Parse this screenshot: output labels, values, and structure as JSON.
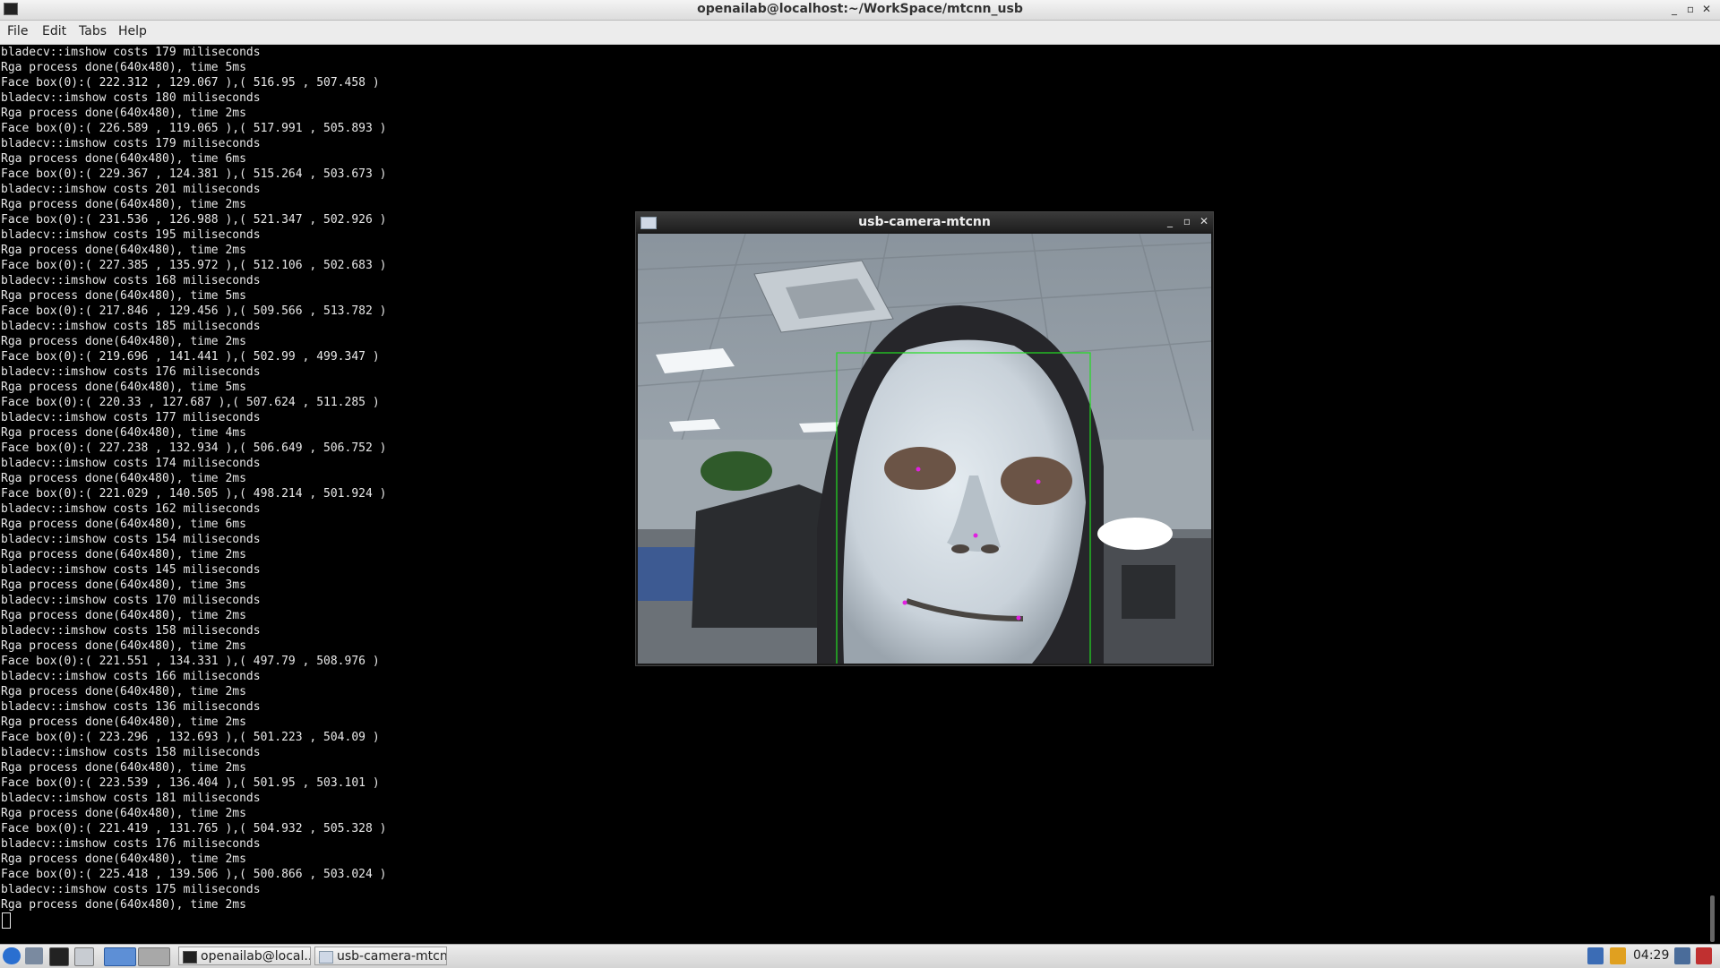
{
  "window": {
    "title": "openailab@localhost:~/WorkSpace/mtcnn_usb",
    "controls": [
      "_",
      "▫",
      "✕"
    ]
  },
  "menu": [
    "File",
    "Edit",
    "Tabs",
    "Help"
  ],
  "terminal_lines": [
    "bladecv::imshow costs 179 miliseconds",
    "Rga process done(640x480), time 5ms",
    "Face box(0):( 222.312 , 129.067 ),( 516.95 , 507.458 )",
    "bladecv::imshow costs 180 miliseconds",
    "Rga process done(640x480), time 2ms",
    "Face box(0):( 226.589 , 119.065 ),( 517.991 , 505.893 )",
    "bladecv::imshow costs 179 miliseconds",
    "Rga process done(640x480), time 6ms",
    "Face box(0):( 229.367 , 124.381 ),( 515.264 , 503.673 )",
    "bladecv::imshow costs 201 miliseconds",
    "Rga process done(640x480), time 2ms",
    "Face box(0):( 231.536 , 126.988 ),( 521.347 , 502.926 )",
    "bladecv::imshow costs 195 miliseconds",
    "Rga process done(640x480), time 2ms",
    "Face box(0):( 227.385 , 135.972 ),( 512.106 , 502.683 )",
    "bladecv::imshow costs 168 miliseconds",
    "Rga process done(640x480), time 5ms",
    "Face box(0):( 217.846 , 129.456 ),( 509.566 , 513.782 )",
    "bladecv::imshow costs 185 miliseconds",
    "Rga process done(640x480), time 2ms",
    "Face box(0):( 219.696 , 141.441 ),( 502.99 , 499.347 )",
    "bladecv::imshow costs 176 miliseconds",
    "Rga process done(640x480), time 5ms",
    "Face box(0):( 220.33 , 127.687 ),( 507.624 , 511.285 )",
    "bladecv::imshow costs 177 miliseconds",
    "Rga process done(640x480), time 4ms",
    "Face box(0):( 227.238 , 132.934 ),( 506.649 , 506.752 )",
    "bladecv::imshow costs 174 miliseconds",
    "Rga process done(640x480), time 2ms",
    "Face box(0):( 221.029 , 140.505 ),( 498.214 , 501.924 )",
    "bladecv::imshow costs 162 miliseconds",
    "Rga process done(640x480), time 6ms",
    "bladecv::imshow costs 154 miliseconds",
    "Rga process done(640x480), time 2ms",
    "bladecv::imshow costs 145 miliseconds",
    "Rga process done(640x480), time 3ms",
    "bladecv::imshow costs 170 miliseconds",
    "Rga process done(640x480), time 2ms",
    "bladecv::imshow costs 158 miliseconds",
    "Rga process done(640x480), time 2ms",
    "Face box(0):( 221.551 , 134.331 ),( 497.79 , 508.976 )",
    "bladecv::imshow costs 166 miliseconds",
    "Rga process done(640x480), time 2ms",
    "bladecv::imshow costs 136 miliseconds",
    "Rga process done(640x480), time 2ms",
    "Face box(0):( 223.296 , 132.693 ),( 501.223 , 504.09 )",
    "bladecv::imshow costs 158 miliseconds",
    "Rga process done(640x480), time 2ms",
    "Face box(0):( 223.539 , 136.404 ),( 501.95 , 503.101 )",
    "bladecv::imshow costs 181 miliseconds",
    "Rga process done(640x480), time 2ms",
    "Face box(0):( 221.419 , 131.765 ),( 504.932 , 505.328 )",
    "bladecv::imshow costs 176 miliseconds",
    "Rga process done(640x480), time 2ms",
    "Face box(0):( 225.418 , 139.506 ),( 500.866 , 503.024 )",
    "bladecv::imshow costs 175 miliseconds",
    "Rga process done(640x480), time 2ms"
  ],
  "camera_window": {
    "title": "usb-camera-mtcnn",
    "controls": [
      "_",
      "▫",
      "✕"
    ],
    "colors": {
      "box": "#22dd22",
      "landmark": "#e020e0"
    }
  },
  "taskbar": {
    "tasks": [
      {
        "label": "openailab@local..."
      },
      {
        "label": "usb-camera-mtcnn"
      }
    ],
    "clock": "04:29"
  }
}
